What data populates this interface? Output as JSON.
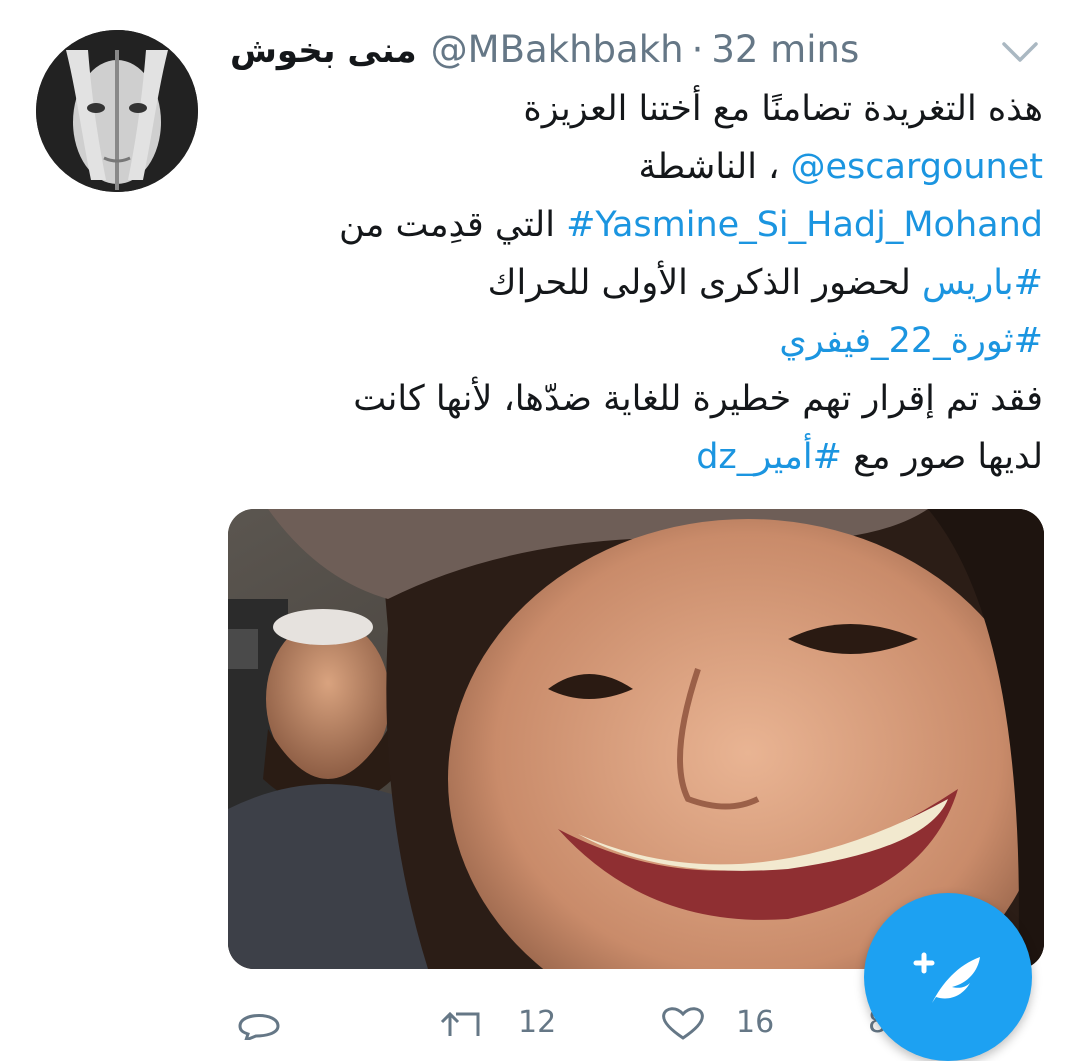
{
  "tweet": {
    "display_name": "منى بخوش",
    "handle": "@MBakhbakh",
    "separator": "·",
    "time": "32 mins",
    "lines": {
      "l1": "هذه التغريدة تضامنًا مع أختنا العزيزة",
      "l2_mention": "@escargounet",
      "l2_text": " ، الناشطة",
      "l3_hashtag": "#Yasmine_Si_Hadj_Mohand",
      "l3_text": "التي قدِمت من ",
      "l4_hashtag": "#باريس",
      "l4_text": "  لحضور الذكرى الأولى للحراك",
      "l5_hashtag": "#ثورة_22_فيفري",
      "l6": "فقد تم إقرار تهم خطيرة للغاية ضدّها، لأنها كانت",
      "l7_text": "لديها صور مع ",
      "l7_hashtag": "#أمير_dz"
    },
    "media": {
      "icon": "photo"
    },
    "actions": {
      "reply_icon": "reply-icon",
      "retweet_icon": "retweet-icon",
      "retweet_count": "12",
      "like_icon": "heart-icon",
      "like_count": "16",
      "share_partial": "8"
    }
  },
  "fab": {
    "icon": "compose-tweet-icon"
  },
  "colors": {
    "link": "#1b95e0",
    "secondary_text": "#657786",
    "primary_text": "#14171a",
    "fab": "#1da1f2"
  }
}
